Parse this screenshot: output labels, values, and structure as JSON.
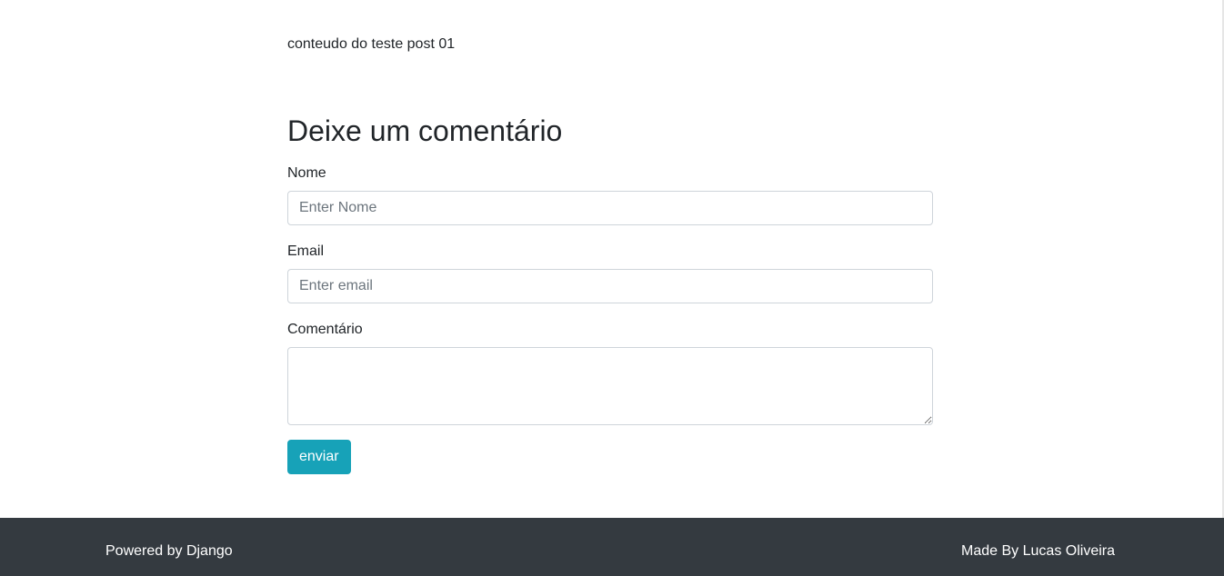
{
  "post": {
    "content": "conteudo do teste post 01"
  },
  "comment_form": {
    "title": "Deixe um comentário",
    "name_label": "Nome",
    "name_placeholder": "Enter Nome",
    "email_label": "Email",
    "email_placeholder": "Enter email",
    "comment_label": "Comentário",
    "submit_label": "enviar"
  },
  "footer": {
    "left_text": "Powered by Django",
    "right_text": "Made By Lucas Oliveira"
  },
  "colors": {
    "accent": "#17a2b8",
    "footer_bg": "#343a40"
  }
}
